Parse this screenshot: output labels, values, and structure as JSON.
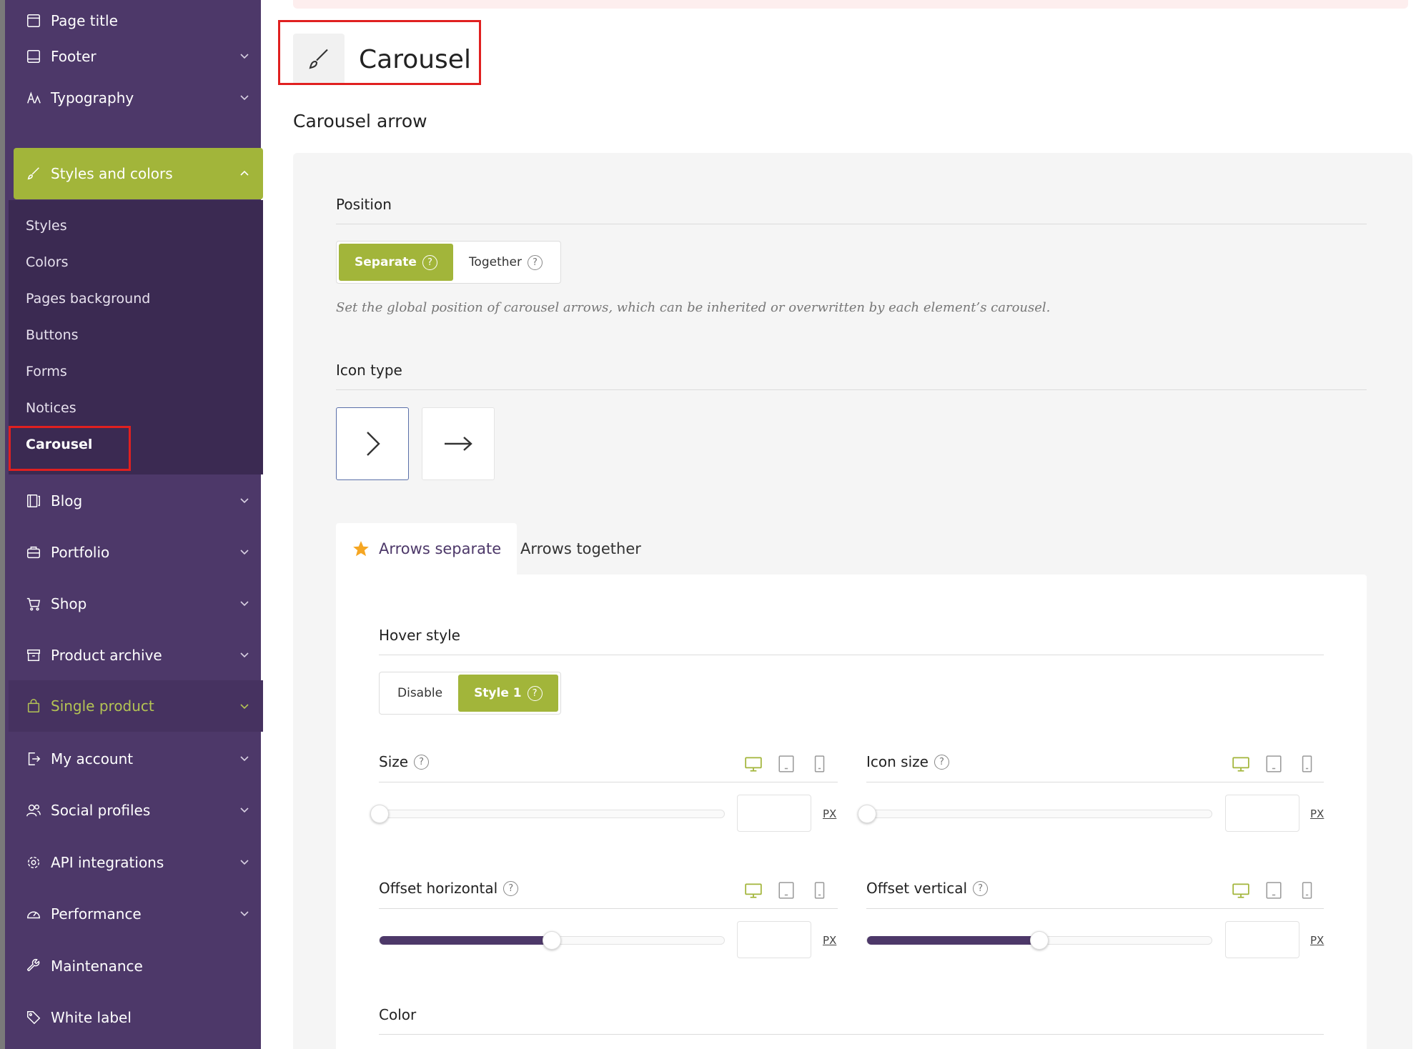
{
  "sidebar": {
    "items": [
      {
        "label": "Page title",
        "icon": "page-icon"
      },
      {
        "label": "Footer",
        "icon": "footer-icon"
      },
      {
        "label": "Typography",
        "icon": "typography-icon"
      },
      {
        "label": "Styles and colors",
        "icon": "brush-icon"
      },
      {
        "label": "Blog",
        "icon": "blog-icon"
      },
      {
        "label": "Portfolio",
        "icon": "briefcase-icon"
      },
      {
        "label": "Shop",
        "icon": "cart-icon"
      },
      {
        "label": "Product archive",
        "icon": "archive-icon"
      },
      {
        "label": "Single product",
        "icon": "bag-icon"
      },
      {
        "label": "My account",
        "icon": "account-icon"
      },
      {
        "label": "Social profiles",
        "icon": "users-icon"
      },
      {
        "label": "API integrations",
        "icon": "gear-icon"
      },
      {
        "label": "Performance",
        "icon": "gauge-icon"
      },
      {
        "label": "Maintenance",
        "icon": "wrench-icon"
      },
      {
        "label": "White label",
        "icon": "tag-icon"
      }
    ],
    "submenu": [
      "Styles",
      "Colors",
      "Pages background",
      "Buttons",
      "Forms",
      "Notices",
      "Carousel"
    ]
  },
  "header": {
    "title": "Carousel",
    "section": "Carousel arrow"
  },
  "position": {
    "label": "Position",
    "options": [
      "Separate",
      "Together"
    ],
    "selected": "Separate",
    "description": "Set the global position of carousel arrows, which can be inherited or overwritten by each element’s carousel."
  },
  "icon_type": {
    "label": "Icon type",
    "options": [
      "chevron-right-icon",
      "arrow-right-icon"
    ],
    "selected": "chevron-right-icon"
  },
  "tabs": [
    "Arrows separate",
    "Arrows together"
  ],
  "hover_style": {
    "label": "Hover style",
    "options": [
      "Disable",
      "Style 1"
    ],
    "selected": "Style 1"
  },
  "size": {
    "label": "Size",
    "unit": "PX",
    "level": 0
  },
  "icon_size": {
    "label": "Icon size",
    "unit": "PX",
    "level": 0
  },
  "offset_horizontal": {
    "label": "Offset horizontal",
    "unit": "PX",
    "level": 0.5
  },
  "offset_vertical": {
    "label": "Offset vertical",
    "unit": "PX",
    "level": 0.5
  },
  "color": {
    "label": "Color"
  },
  "colors": {
    "sidebar": "#4d3869",
    "accent": "#a2b53a",
    "highlight_text": "#b4c454",
    "callout": "#e02020"
  }
}
